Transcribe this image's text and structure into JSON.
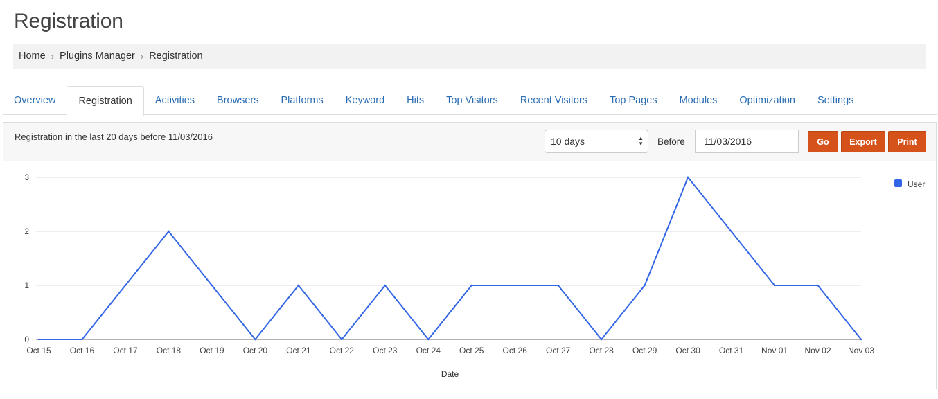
{
  "page": {
    "title": "Registration"
  },
  "breadcrumb": {
    "items": [
      "Home",
      "Plugins Manager",
      "Registration"
    ]
  },
  "tabs": [
    {
      "label": "Overview",
      "active": false
    },
    {
      "label": "Registration",
      "active": true
    },
    {
      "label": "Activities",
      "active": false
    },
    {
      "label": "Browsers",
      "active": false
    },
    {
      "label": "Platforms",
      "active": false
    },
    {
      "label": "Keyword",
      "active": false
    },
    {
      "label": "Hits",
      "active": false
    },
    {
      "label": "Top Visitors",
      "active": false
    },
    {
      "label": "Recent Visitors",
      "active": false
    },
    {
      "label": "Top Pages",
      "active": false
    },
    {
      "label": "Modules",
      "active": false
    },
    {
      "label": "Optimization",
      "active": false
    },
    {
      "label": "Settings",
      "active": false
    }
  ],
  "toolbar": {
    "caption": "Registration in the last 20 days before 11/03/2016",
    "range_selected": "10 days",
    "before_label": "Before",
    "date_value": "11/03/2016",
    "go_label": "Go",
    "export_label": "Export",
    "print_label": "Print"
  },
  "colors": {
    "accent": "#d6521b",
    "link": "#2a6db3",
    "series": "#3366e6"
  },
  "chart_data": {
    "type": "line",
    "x": [
      "Oct 15",
      "Oct 16",
      "Oct 17",
      "Oct 18",
      "Oct 19",
      "Oct 20",
      "Oct 21",
      "Oct 22",
      "Oct 23",
      "Oct 24",
      "Oct 25",
      "Oct 26",
      "Oct 27",
      "Oct 28",
      "Oct 29",
      "Oct 30",
      "Oct 31",
      "Nov 01",
      "Nov 02",
      "Nov 03"
    ],
    "series": [
      {
        "name": "User",
        "values": [
          0,
          0,
          1,
          2,
          1,
          0,
          1,
          0,
          1,
          0,
          1,
          1,
          1,
          0,
          1,
          3,
          2,
          1,
          1,
          0
        ]
      }
    ],
    "xlabel": "Date",
    "ylabel": "",
    "ylim": [
      0,
      3
    ],
    "yticks": [
      0,
      1,
      2,
      3
    ],
    "grid": true,
    "legend": "top-right"
  }
}
